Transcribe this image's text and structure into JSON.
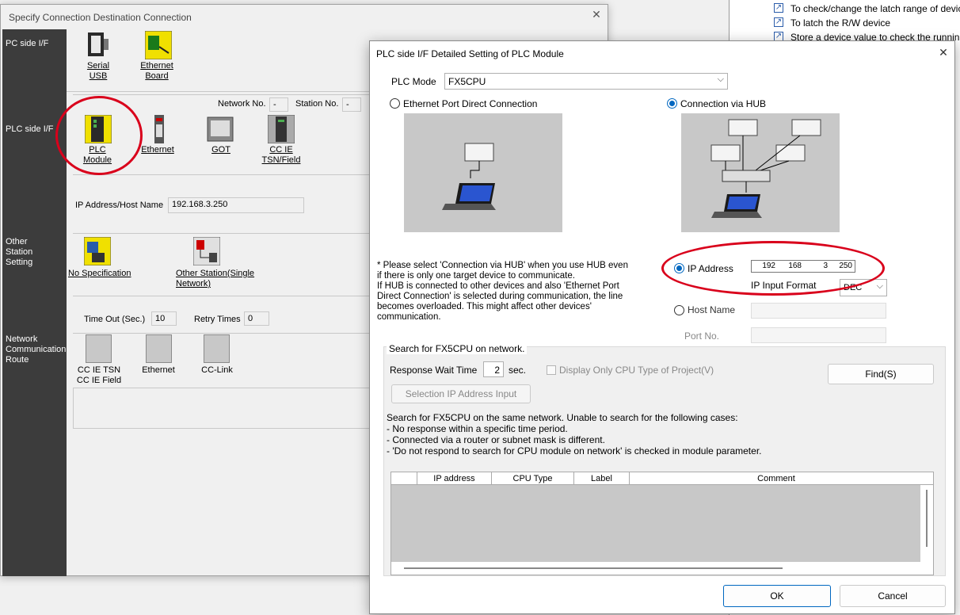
{
  "bg_window": {
    "list_items": [
      "To check/change the latch range of devic",
      "To latch the R/W device",
      "Store a device value to check the running"
    ]
  },
  "specify_dialog": {
    "title": "Specify Connection Destination Connection",
    "sidebar": {
      "pc_side": "PC side I/F",
      "plc_side": "PLC side I/F",
      "other_station": "Other\nStation\nSetting",
      "network_route": "Network\nCommunication\nRoute"
    },
    "pc_side_items": [
      {
        "label": "Serial\nUSB"
      },
      {
        "label": "Ethernet\nBoard"
      }
    ],
    "network_no_label": "Network No.",
    "network_no_value": "-",
    "station_no_label": "Station No.",
    "station_no_value": "-",
    "plc_side_items": [
      {
        "label": "PLC\nModule"
      },
      {
        "label": "Ethernet"
      },
      {
        "label": "GOT"
      },
      {
        "label": "CC IE\nTSN/Field"
      }
    ],
    "ip_label": "IP Address/Host Name",
    "ip_value": "192.168.3.250",
    "other_station_items": [
      {
        "label": "No Specification"
      },
      {
        "label": "Other Station(Single\nNetwork)"
      }
    ],
    "timeout_label": "Time Out (Sec.)",
    "timeout_value": "10",
    "retry_label": "Retry Times",
    "retry_value": "0",
    "route_items": [
      {
        "label": "CC IE TSN\nCC IE Field"
      },
      {
        "label": "Ethernet"
      },
      {
        "label": "CC-Link"
      }
    ]
  },
  "detail_dialog": {
    "title": "PLC side I/F Detailed Setting of PLC Module",
    "plc_mode_label": "PLC Mode",
    "plc_mode_value": "FX5CPU",
    "direct_label": "Ethernet Port Direct Connection",
    "hub_label": "Connection via HUB",
    "note": "* Please select 'Connection via HUB' when you use HUB even\nif there is only one target device to communicate.\nIf HUB is connected to other devices and also 'Ethernet Port\nDirect Connection' is selected during communication, the line\nbecomes overloaded. This might affect other devices'\ncommunication.",
    "ip_address_label": "IP Address",
    "ip_octets": [
      "192",
      "168",
      "3",
      "250"
    ],
    "ip_format_label": "IP Input Format",
    "ip_format_value": "DEC",
    "host_name_label": "Host Name",
    "port_no_label": "Port No.",
    "search_title": "Search for FX5CPU on network.",
    "response_wait_label": "Response Wait Time",
    "response_wait_value": "2",
    "response_wait_unit": "sec.",
    "display_only_label": "Display Only CPU Type of Project(V)",
    "find_label": "Find(S)",
    "selection_ip_label": "Selection IP Address Input",
    "search_note": "Search for FX5CPU on the same network. Unable to search for the following cases:\n- No response within a specific time period.\n- Connected via a router or subnet mask is different.\n- 'Do not respond to search for CPU module on network' is checked in module parameter.",
    "table_headers": [
      "",
      "IP address",
      "CPU Type",
      "Label",
      "Comment"
    ],
    "ok_label": "OK",
    "cancel_label": "Cancel"
  },
  "colors": {
    "sidebar": "#3c3c3c",
    "accent": "#0067c0",
    "annotation": "#d9001b"
  }
}
